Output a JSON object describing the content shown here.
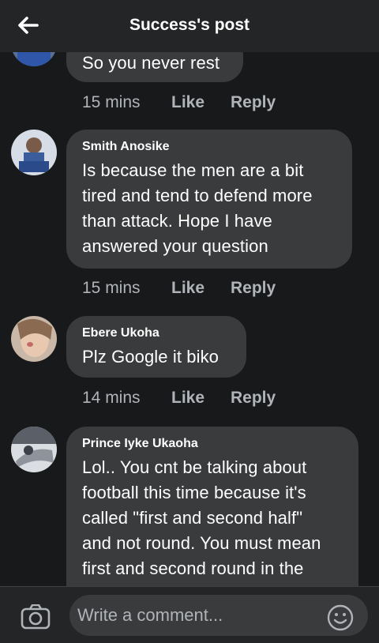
{
  "header": {
    "title": "Success's post",
    "back_icon": "arrow-left-icon"
  },
  "comments": [
    {
      "author": "",
      "text_lines": [
        "So you never rest"
      ],
      "time": "15 mins",
      "like": "Like",
      "reply": "Reply"
    },
    {
      "author": "Smith Anosike",
      "text_lines": [
        "Is because the men are a bit",
        "tired and tend to defend more",
        "than attack. Hope I have",
        "answered your question"
      ],
      "time": "15 mins",
      "like": "Like",
      "reply": "Reply"
    },
    {
      "author": "Ebere Ukoha",
      "text_lines": [
        "Plz Google it biko"
      ],
      "time": "14 mins",
      "like": "Like",
      "reply": "Reply"
    },
    {
      "author": "Prince Iyke Ukaoha",
      "text_lines": [
        "Lol.. You cnt be talking about",
        "football this time because it's",
        "called \"first and second half\"",
        "and not round. You must mean",
        "first and second round in the"
      ]
    }
  ],
  "composer": {
    "placeholder": "Write a comment...",
    "camera_icon": "camera-icon",
    "emoji_icon": "emoji-icon"
  },
  "colors": {
    "background": "#18191a",
    "bubble": "#3a3b3c",
    "meta_text": "#b0b3b8",
    "header": "#242526"
  }
}
